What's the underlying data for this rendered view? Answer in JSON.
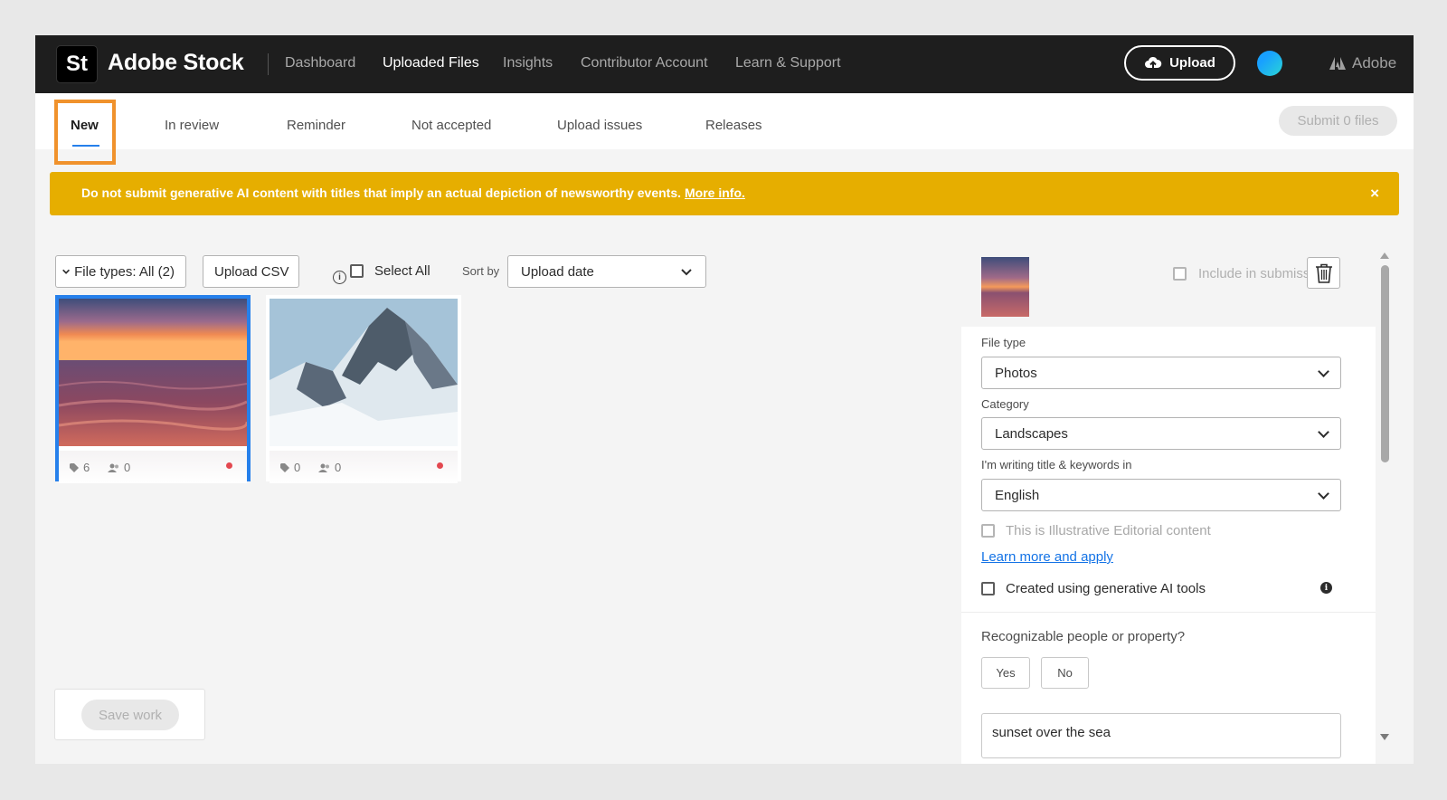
{
  "topbar": {
    "logo": "St",
    "brand": "Adobe Stock",
    "nav": [
      "Dashboard",
      "Uploaded Files",
      "Insights",
      "Contributor Account",
      "Learn & Support"
    ],
    "active_nav": "Uploaded Files",
    "upload_label": "Upload",
    "adobe_label": "Adobe"
  },
  "tabs": {
    "items": [
      "New",
      "In review",
      "Reminder",
      "Not accepted",
      "Upload issues",
      "Releases"
    ],
    "active": "New",
    "submit_label": "Submit 0 files"
  },
  "banner": {
    "text": "Do not submit generative AI content with titles that imply an actual depiction of newsworthy events.",
    "link": "More info.",
    "close": "×",
    "color": "#e6ae00"
  },
  "toolbar": {
    "file_types": "File types: All (2)",
    "upload_csv": "Upload CSV",
    "select_all": "Select All",
    "sort_by": "Sort by",
    "sort_value": "Upload date"
  },
  "files": [
    {
      "keywords": "6",
      "releases": "0",
      "selected": true,
      "image": "sunset-over-sea"
    },
    {
      "keywords": "0",
      "releases": "0",
      "selected": false,
      "image": "snowy-mountain"
    }
  ],
  "save_label": "Save work",
  "panel": {
    "include_label": "Include in submission",
    "file_type_label": "File type",
    "file_type_value": "Photos",
    "category_label": "Category",
    "category_value": "Landscapes",
    "language_label": "I'm writing title & keywords in",
    "language_value": "English",
    "editorial_label": "This is Illustrative Editorial content",
    "learn_link": "Learn more and apply",
    "ai_label": "Created using generative AI tools",
    "people_question": "Recognizable people or property?",
    "yes": "Yes",
    "no": "No",
    "title_value": "sunset over the sea"
  },
  "colors": {
    "accent": "#2680eb",
    "highlight": "#f0922c",
    "link": "#1473e6"
  }
}
